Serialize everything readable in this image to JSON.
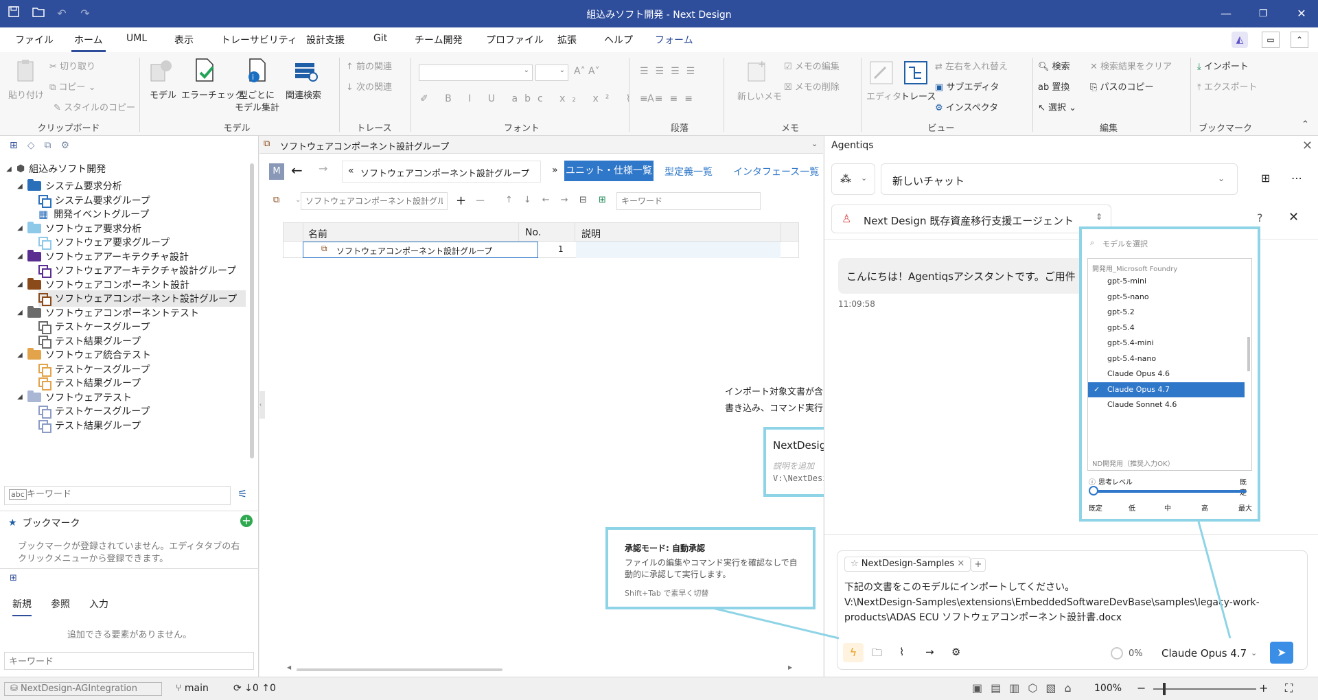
{
  "window": {
    "title": "組込みソフト開発 - Next Design"
  },
  "menu_tabs": [
    "ファイル",
    "ホーム",
    "UML",
    "表示",
    "トレーサビリティ",
    "設計支援",
    "Git",
    "チーム開発",
    "プロファイル",
    "拡張",
    "ヘルプ",
    "フォーム"
  ],
  "ribbon": {
    "clipboard": {
      "paste": "貼り付け",
      "cut": "切り取り",
      "copy": "コピー",
      "style_copy": "スタイルのコピー",
      "group": "クリップボード"
    },
    "model": {
      "model": "モデル",
      "error_check": "エラーチェック",
      "per_type": "型ごとに",
      "model_agg": "モデル集計",
      "related_search": "関連検索",
      "group": "モデル"
    },
    "trace": {
      "prev": "前の関連",
      "next": "次の関連",
      "group": "トレース"
    },
    "font": {
      "group": "フォント"
    },
    "paragraph": {
      "group": "段落"
    },
    "memo": {
      "new": "新しいメモ",
      "edit": "メモの編集",
      "delete": "メモの削除",
      "group": "メモ"
    },
    "view": {
      "editor": "エディタ",
      "trace": "トレース",
      "swap": "左右を入れ替え",
      "sub_editor": "サブエディタ",
      "inspector": "インスペクタ",
      "group": "ビュー"
    },
    "edit": {
      "search": "検索",
      "replace": "置換",
      "select": "選択",
      "clear_results": "検索結果をクリア",
      "copy_path": "パスのコピー",
      "group": "編集"
    },
    "bookmark": {
      "import": "インポート",
      "export": "エクスポート",
      "group": "ブックマーク"
    }
  },
  "tree": {
    "root": "組込みソフト開発",
    "items": [
      {
        "label": "システム要求分析",
        "level": 1,
        "kind": "folder",
        "color": "#2a6fba"
      },
      {
        "label": "システム要求グループ",
        "level": 2,
        "kind": "grp",
        "color": "#2a6fba"
      },
      {
        "label": "開発イベントグループ",
        "level": 2,
        "kind": "table",
        "color": "#2a6fba"
      },
      {
        "label": "ソフトウェア要求分析",
        "level": 1,
        "kind": "folder",
        "color": "#8fc9ea"
      },
      {
        "label": "ソフトウェア要求グループ",
        "level": 2,
        "kind": "grp",
        "color": "#8fc9ea"
      },
      {
        "label": "ソフトウェアアーキテクチャ設計",
        "level": 1,
        "kind": "folder",
        "color": "#5a2d91"
      },
      {
        "label": "ソフトウェアアーキテクチャ設計グループ",
        "level": 2,
        "kind": "grp",
        "color": "#5a2d91"
      },
      {
        "label": "ソフトウェアコンポーネント設計",
        "level": 1,
        "kind": "folder",
        "color": "#8a4a1a"
      },
      {
        "label": "ソフトウェアコンポーネント設計グループ",
        "level": 2,
        "kind": "grp",
        "color": "#8a4a1a",
        "selected": true
      },
      {
        "label": "ソフトウェアコンポーネントテスト",
        "level": 1,
        "kind": "folder",
        "color": "#6b6b6b"
      },
      {
        "label": "テストケースグループ",
        "level": 2,
        "kind": "grp",
        "color": "#6b6b6b"
      },
      {
        "label": "テスト結果グループ",
        "level": 2,
        "kind": "grp",
        "color": "#6b6b6b"
      },
      {
        "label": "ソフトウェア統合テスト",
        "level": 1,
        "kind": "folder",
        "color": "#e2a34a"
      },
      {
        "label": "テストケースグループ",
        "level": 2,
        "kind": "grp",
        "color": "#e2a34a"
      },
      {
        "label": "テスト結果グループ",
        "level": 2,
        "kind": "grp",
        "color": "#e2a34a"
      },
      {
        "label": "ソフトウェアテスト",
        "level": 1,
        "kind": "folder",
        "color": "#a9b6d4"
      },
      {
        "label": "テストケースグループ",
        "level": 2,
        "kind": "grp",
        "color": "#8a9cc6"
      },
      {
        "label": "テスト結果グループ",
        "level": 2,
        "kind": "grp",
        "color": "#8a9cc6"
      }
    ],
    "search_placeholder": "キーワード"
  },
  "bookmark": {
    "title": "ブックマーク",
    "empty": "ブックマークが登録されていません。エディタタブの右クリックメニューから登録できます。"
  },
  "toolbox": {
    "tabs": [
      "新規",
      "参照",
      "入力"
    ],
    "empty": "追加できる要素がありません。",
    "placeholder": "キーワード"
  },
  "editor": {
    "tab_title": "ソフトウェアコンポーネント設計グループ",
    "breadcrumb": "ソフトウェアコンポーネント設計グループ",
    "views": [
      "ユニット・仕様一覧",
      "型定義一覧",
      "インタフェース一覧"
    ],
    "filter_placeholder": "ソフトウェアコンポーネント設計グル-",
    "keyword_placeholder": "キーワード",
    "columns": [
      "名前",
      "No.",
      "説明"
    ],
    "rows": [
      {
        "name": "ソフトウェアコンポーネント設計グループ",
        "no": "1",
        "desc": ""
      }
    ]
  },
  "annotations": {
    "folder_note_1": "インポート対象文書が含まれるフォルダを設定",
    "folder_note_2": "書き込み、コマンド実行はOFF推奨",
    "folder_card": {
      "name": "NextDesign-Samples",
      "desc_placeholder": "説明を追加",
      "path": "V:\\NextDesign-Samples"
    },
    "approval": {
      "title": "承認モード: 自動承認",
      "desc": "ファイルの編集やコマンド実行を確認なしで自動的に承認して実行します。",
      "hint": "Shift+Tab で素早く切替"
    }
  },
  "agent": {
    "panel_title": "Agentiqs",
    "chat_select": "新しいチャット",
    "agent_name": "Next Design 既存資産移行支援エージェント",
    "greeting": "こんにちは！Agentiqsアシスタントです。ご用件",
    "time": "11:09:58",
    "attachment": "NextDesign-Samples",
    "prompt_line1": "下記の文書をこのモデルにインポートしてください。",
    "prompt_line2": "V:\\NextDesign-Samples\\extensions\\EmbeddedSoftwareDevBase\\samples\\legacy-work-",
    "prompt_line3": "products\\ADAS ECU ソフトウェアコンポーネント設計書.docx",
    "progress": "0%",
    "model": "Claude Opus 4.7"
  },
  "model_picker": {
    "search_placeholder": "モデルを選択",
    "group": "開発用_Microsoft Foundry",
    "models": [
      "gpt-5-mini",
      "gpt-5-nano",
      "gpt-5.2",
      "gpt-5.4",
      "gpt-5.4-mini",
      "gpt-5.4-nano",
      "Claude Opus 4.6",
      "Claude Opus 4.7",
      "Claude Sonnet 4.6"
    ],
    "selected": "Claude Opus 4.7",
    "next_group": "ND開発用（推奨入力OK）",
    "effort_label": "思考レベル",
    "effort_value": "既定",
    "effort_ticks": [
      "既定",
      "低",
      "中",
      "高",
      "最大"
    ]
  },
  "status": {
    "project": "NextDesign-AGIntegration",
    "branch": "main",
    "down": "0",
    "up": "0",
    "zoom": "100%"
  }
}
